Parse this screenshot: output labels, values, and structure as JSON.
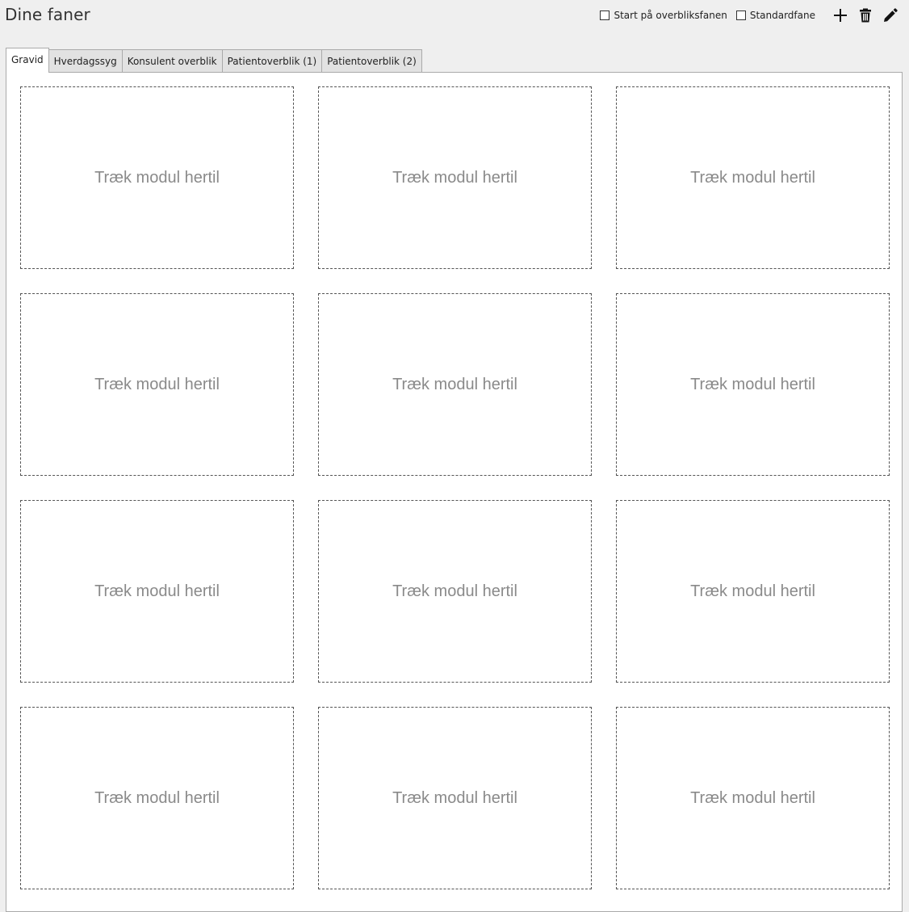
{
  "header": {
    "title": "Dine faner"
  },
  "toolbar": {
    "start_overview_label": "Start på overbliksfanen",
    "start_overview_checked": false,
    "default_tab_label": "Standardfane",
    "default_tab_checked": false,
    "add_icon": "plus-icon",
    "delete_icon": "trash-icon",
    "edit_icon": "pencil-icon"
  },
  "tabs": [
    {
      "label": "Gravid",
      "active": true
    },
    {
      "label": "Hverdagssyg",
      "active": false
    },
    {
      "label": "Konsulent overblik",
      "active": false
    },
    {
      "label": "Patientoverblik (1)",
      "active": false
    },
    {
      "label": "Patientoverblik (2)",
      "active": false
    }
  ],
  "dropzones": {
    "label": "Træk modul hertil",
    "rows": 4,
    "columns": 3
  },
  "colors": {
    "background": "#efefef",
    "panel": "#ffffff",
    "border": "#aaaaaa",
    "dashed": "#555555",
    "placeholder_text": "#8a8a8a"
  }
}
